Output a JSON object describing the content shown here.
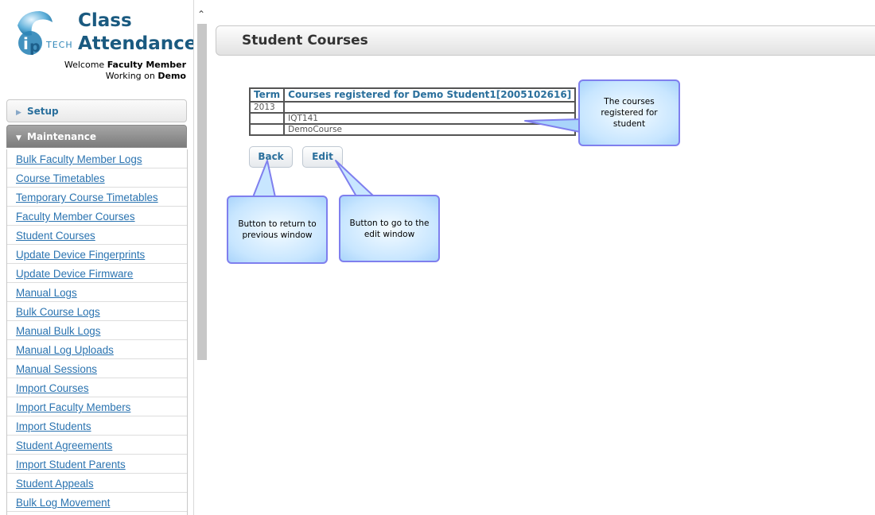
{
  "app": {
    "title_line1": "Class",
    "title_line2": "Attendance",
    "logo_text": "TECH",
    "welcome_prefix": "Welcome",
    "user_name": "Faculty Member",
    "working_prefix": "Working on",
    "workspace": "Demo"
  },
  "sidebar": {
    "sections": {
      "setup": "Setup",
      "maintenance": "Maintenance"
    },
    "items": [
      "Bulk Faculty Member Logs",
      "Course Timetables",
      "Temporary Course Timetables",
      "Faculty Member Courses",
      "Student Courses",
      "Update Device Fingerprints",
      "Update Device Firmware",
      "Manual Logs",
      "Bulk Course Logs",
      "Manual Bulk Logs",
      "Manual Log Uploads",
      "Manual Sessions",
      "Import Courses",
      "Import Faculty Members",
      "Import Students",
      "Student Agreements",
      "Import Student Parents",
      "Student Appeals",
      "Bulk Log Movement"
    ]
  },
  "main": {
    "page_title": "Student Courses",
    "table": {
      "headers": [
        "Term",
        "Courses registered for Demo Student1[2005102616]"
      ],
      "rows": [
        [
          "2013",
          ""
        ],
        [
          "",
          "IQT141"
        ],
        [
          "",
          "DemoCourse"
        ]
      ]
    },
    "buttons": {
      "back": "Back",
      "edit": "Edit"
    },
    "callouts": {
      "courses": "The courses registered for student",
      "back": "Button to return to previous window",
      "edit": "Button to go to the edit window"
    }
  },
  "colors": {
    "accent": "#2a6f9c",
    "link": "#2a73b0",
    "callout_border": "#7f7fee",
    "callout_fill": "#c8e6ff"
  }
}
